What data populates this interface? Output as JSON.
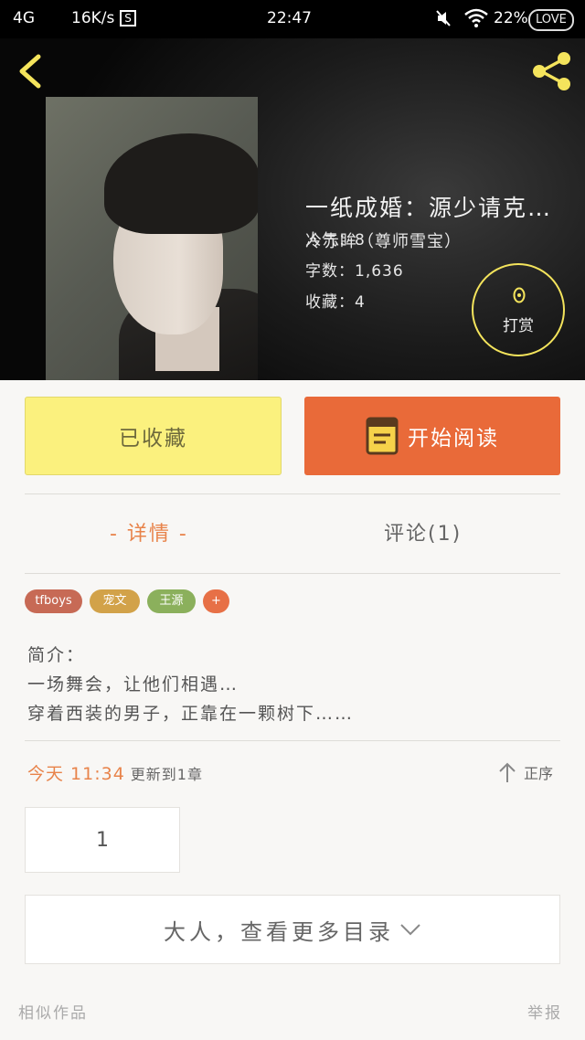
{
  "status_bar": {
    "network": "4G",
    "speed": "16K/s",
    "sim_badge": "S",
    "time": "22:47",
    "battery": "22%",
    "love_badge": "LOVE"
  },
  "book": {
    "title": "一纸成婚：源少请克…",
    "author": "冷赤眸（尊师雪宝）",
    "popularity_label": "人气：",
    "popularity": "8",
    "word_count_label": "字数：",
    "word_count": "1,636",
    "favorites_label": "收藏：",
    "favorites": "4",
    "reward_label": "打赏"
  },
  "actions": {
    "favorited_label": "已收藏",
    "read_label": "开始阅读"
  },
  "tabs": {
    "detail": "- 详情 -",
    "comments": "评论(1)"
  },
  "tags": [
    "tfboys",
    "宠文",
    "王源",
    "+"
  ],
  "intro": {
    "heading": "简介：",
    "line1": "一场舞会，让他们相遇…",
    "line2": "穿着西装的男子，正靠在一颗树下……"
  },
  "update": {
    "time": "今天 11:34",
    "text": "更新到1章",
    "order": "正序"
  },
  "chapters": [
    "1"
  ],
  "more_catalog": "大人，查看更多目录",
  "footer": {
    "similar": "相似作品",
    "report": "举报"
  },
  "colors": {
    "accent_orange": "#e96a39",
    "fav_yellow": "#fbf17e",
    "reward_ring": "#f4e45c"
  }
}
